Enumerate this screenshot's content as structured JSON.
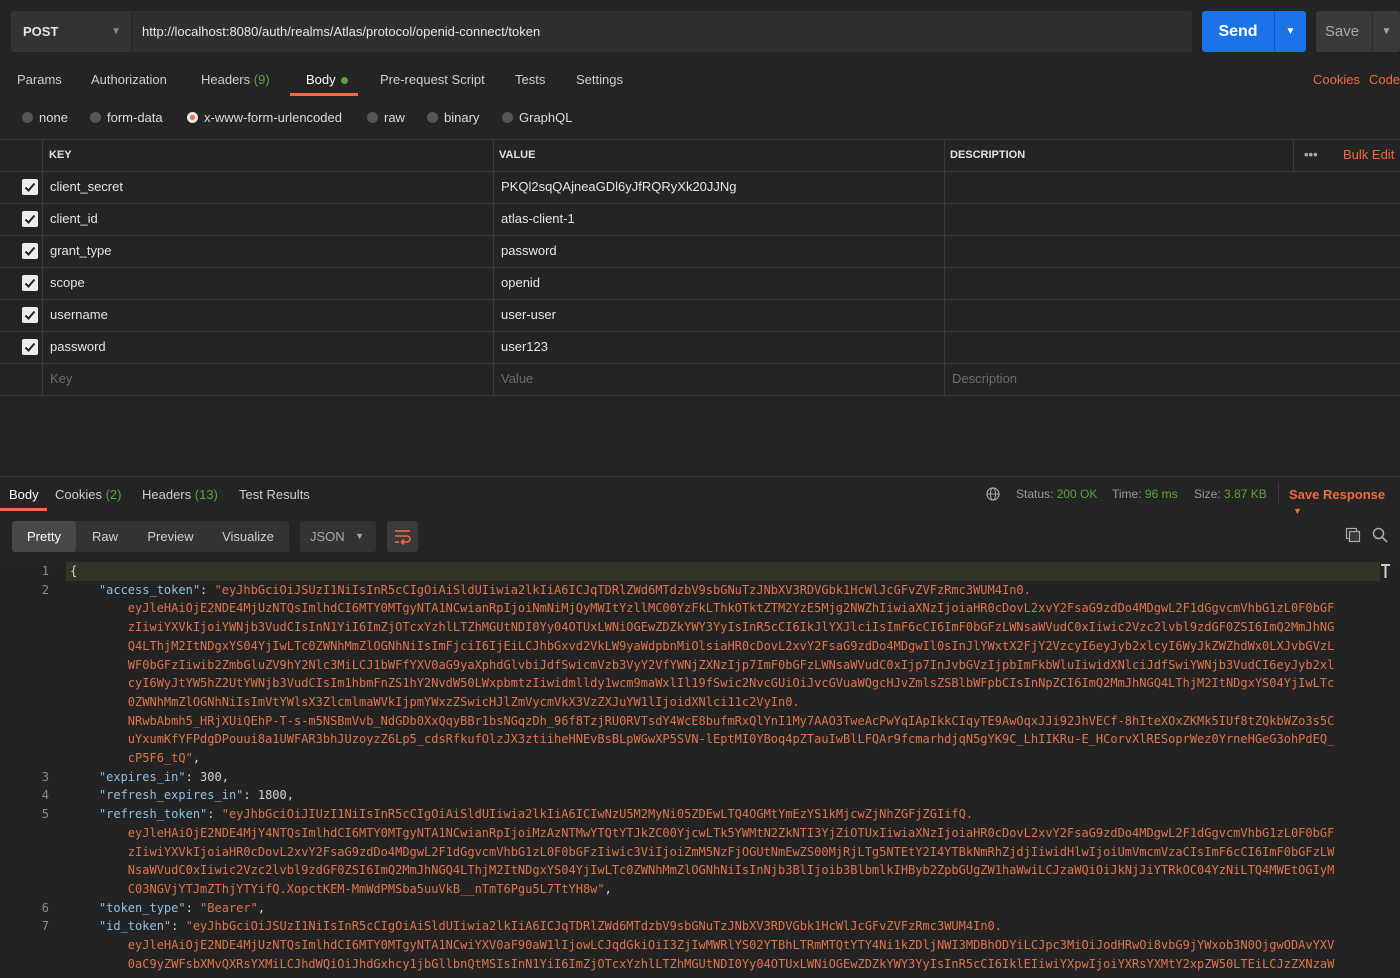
{
  "request": {
    "method": "POST",
    "url": "http://localhost:8080/auth/realms/Atlas/protocol/openid-connect/token",
    "send_label": "Send",
    "save_label": "Save"
  },
  "request_tabs": {
    "params": "Params",
    "authorization": "Authorization",
    "headers": "Headers",
    "headers_count": "(9)",
    "body": "Body",
    "pre_request": "Pre-request Script",
    "tests": "Tests",
    "settings": "Settings",
    "cookies": "Cookies",
    "code": "Code"
  },
  "body_types": {
    "none": "none",
    "form_data": "form-data",
    "urlencoded": "x-www-form-urlencoded",
    "raw": "raw",
    "binary": "binary",
    "graphql": "GraphQL",
    "selected": "x-www-form-urlencoded"
  },
  "table": {
    "headers": {
      "key": "KEY",
      "value": "VALUE",
      "description": "DESCRIPTION",
      "bulk_edit": "Bulk Edit",
      "more": "•••"
    },
    "rows": [
      {
        "key": "client_secret",
        "value": "PKQl2sqQAjneaGDl6yJfRQRyXk20JJNg",
        "checked": true
      },
      {
        "key": "client_id",
        "value": "atlas-client-1",
        "checked": true
      },
      {
        "key": "grant_type",
        "value": "password",
        "checked": true
      },
      {
        "key": "scope",
        "value": "openid",
        "checked": true
      },
      {
        "key": "username",
        "value": "user-user",
        "checked": true
      },
      {
        "key": "password",
        "value": "user123",
        "checked": true
      }
    ],
    "placeholder": {
      "key": "Key",
      "value": "Value",
      "description": "Description"
    }
  },
  "response_tabs": {
    "body": "Body",
    "cookies": "Cookies",
    "cookies_count": "(2)",
    "headers": "Headers",
    "headers_count": "(13)",
    "test_results": "Test Results"
  },
  "response_status": {
    "status_label": "Status:",
    "status_value": "200 OK",
    "time_label": "Time:",
    "time_value": "96 ms",
    "size_label": "Size:",
    "size_value": "3.87 KB",
    "save_response": "Save Response"
  },
  "view_modes": {
    "pretty": "Pretty",
    "raw": "Raw",
    "preview": "Preview",
    "visualize": "Visualize",
    "format": "JSON"
  },
  "code": {
    "lines": [
      {
        "num": "1",
        "parts": [
          [
            "p",
            "{"
          ]
        ]
      },
      {
        "num": "2",
        "parts": [
          [
            "k",
            "    \"access_token\""
          ],
          [
            "p",
            ": "
          ],
          [
            "s",
            "\"eyJhbGciOiJSUzI1NiIsInR5cCIgOiAiSldUIiwia2lkIiA6ICJqTDRlZWd6MTdzbV9sbGNuTzJNbXV3RDVGbk1HcWlJcGFvZVFzRmc3WUM4In0."
          ]
        ]
      },
      {
        "num": "",
        "parts": [
          [
            "s",
            "        eyJleHAiOjE2NDE4MjUzNTQsImlhdCI6MTY0MTgyNTA1NCwianRpIjoiNmNiMjQyMWItYzllMC00YzFkLThkOTktZTM2YzE5Mjg2NWZhIiwiaXNzIjoiaHR0cDovL2xvY2FsaG9zdDo4MDgwL2F1dGgvcmVhbG1zL0F0bGF"
          ]
        ]
      },
      {
        "num": "",
        "parts": [
          [
            "s",
            "        zIiwiYXVkIjoiYWNjb3VudCIsInN1YiI6ImZjOTcxYzhlLTZhMGUtNDI0Yy04OTUxLWNiOGEwZDZkYWY3YyIsInR5cCI6IkJlYXJlciIsImF6cCI6ImF0bGFzLWNsaWVudC0xIiwic2Vzc2lvbl9zdGF0ZSI6ImQ2MmJhNG"
          ]
        ]
      },
      {
        "num": "",
        "parts": [
          [
            "s",
            "        Q4LThjM2ItNDgxYS04YjIwLTc0ZWNhMmZlOGNhNiIsImFjciI6IjEiLCJhbGxvd2VkLW9yaWdpbnMiOlsiaHR0cDovL2xvY2FsaG9zdDo4MDgwIl0sInJlYWxtX2FjY2VzcyI6eyJyb2xlcyI6WyJkZWZhdWx0LXJvbGVzL"
          ]
        ]
      },
      {
        "num": "",
        "parts": [
          [
            "s",
            "        WF0bGFzIiwib2ZmbGluZV9hY2Nlc3MiLCJ1bWFfYXV0aG9yaXphdGlvbiJdfSwicmVzb3VyY2VfYWNjZXNzIjp7ImF0bGFzLWNsaWVudC0xIjp7InJvbGVzIjpbImFkbWluIiwidXNlciJdfSwiYWNjb3VudCI6eyJyb2xl"
          ]
        ]
      },
      {
        "num": "",
        "parts": [
          [
            "s",
            "        cyI6WyJtYW5hZ2UtYWNjb3VudCIsIm1hbmFnZS1hY2NvdW50LWxpbmtzIiwidmlldy1wcm9maWxlIl19fSwic2NvcGUiOiJvcGVuaWQgcHJvZmlsZSBlbWFpbCIsInNpZCI6ImQ2MmJhNGQ4LThjM2ItNDgxYS04YjIwLTc"
          ]
        ]
      },
      {
        "num": "",
        "parts": [
          [
            "s",
            "        0ZWNhMmZlOGNhNiIsImVtYWlsX3ZlcmlmaWVkIjpmYWxzZSwicHJlZmVycmVkX3VzZXJuYW1lIjoidXNlci11c2VyIn0."
          ]
        ]
      },
      {
        "num": "",
        "parts": [
          [
            "s",
            "        NRwbAbmh5_HRjXUiQEhP-T-s-m5NSBmVvb_NdGDb0XxQqyBBr1bsNGqzDh_96f8TzjRU0RVTsdY4WcE8bufmRxQlYnI1My7AAO3TweAcPwYqIApIkkCIqyTE9AwOqxJJi92JhVECf-8hIteXOxZKMk5IUf8tZQkbWZo3s5C"
          ]
        ]
      },
      {
        "num": "",
        "parts": [
          [
            "s",
            "        uYxumKfYFPdgDPouui8a1UWFAR3bhJUzoyzZ6Lp5_cdsRfkufOlzJX3ztiiheHNEvBsBLpWGwXP5SVN-lEptMI0YBoq4pZTauIwBlLFQAr9fcmarhdjqN5gYK9C_LhIIKRu-E_HCorvXlRESoprWez0YrneHGeG3ohPdEQ_"
          ]
        ]
      },
      {
        "num": "",
        "parts": [
          [
            "s",
            "        cP5F6_tQ\""
          ],
          [
            "p",
            ","
          ]
        ]
      },
      {
        "num": "3",
        "parts": [
          [
            "k",
            "    \"expires_in\""
          ],
          [
            "p",
            ": 300,"
          ]
        ]
      },
      {
        "num": "4",
        "parts": [
          [
            "k",
            "    \"refresh_expires_in\""
          ],
          [
            "p",
            ": 1800,"
          ]
        ]
      },
      {
        "num": "5",
        "parts": [
          [
            "k",
            "    \"refresh_token\""
          ],
          [
            "p",
            ": "
          ],
          [
            "s",
            "\"eyJhbGciOiJIUzI1NiIsInR5cCIgOiAiSldUIiwia2lkIiA6ICIwNzU5M2MyNi05ZDEwLTQ4OGMtYmEzYS1kMjcwZjNhZGFjZGIifQ."
          ]
        ]
      },
      {
        "num": "",
        "parts": [
          [
            "s",
            "        eyJleHAiOjE2NDE4MjY4NTQsImlhdCI6MTY0MTgyNTA1NCwianRpIjoiMzAzNTMwYTQtYTJkZC00YjcwLTk5YWMtN2ZkNTI3YjZiOTUxIiwiaXNzIjoiaHR0cDovL2xvY2FsaG9zdDo4MDgwL2F1dGgvcmVhbG1zL0F0bGF"
          ]
        ]
      },
      {
        "num": "",
        "parts": [
          [
            "s",
            "        zIiwiYXVkIjoiaHR0cDovL2xvY2FsaG9zdDo4MDgwL2F1dGgvcmVhbG1zL0F0bGFzIiwic3ViIjoiZmM5NzFjOGUtNmEwZS00MjRjLTg5NTEtY2I4YTBkNmRhZjdjIiwidHlwIjoiUmVmcmVzaCIsImF6cCI6ImF0bGFzLW"
          ]
        ]
      },
      {
        "num": "",
        "parts": [
          [
            "s",
            "        NsaWVudC0xIiwic2Vzc2lvbl9zdGF0ZSI6ImQ2MmJhNGQ4LThjM2ItNDgxYS04YjIwLTc0ZWNhMmZlOGNhNiIsInNjb3BlIjoib3BlbmlkIHByb2ZpbGUgZW1haWwiLCJzaWQiOiJkNjJiYTRkOC04YzNiLTQ4MWEtOGIyM"
          ]
        ]
      },
      {
        "num": "",
        "parts": [
          [
            "s",
            "        C03NGVjYTJmZThjYTYifQ.XopctKEM-MmWdPMSba5uuVkB__nTmT6Pgu5L7TtYH8w\""
          ],
          [
            "p",
            ","
          ]
        ]
      },
      {
        "num": "6",
        "parts": [
          [
            "k",
            "    \"token_type\""
          ],
          [
            "p",
            ": "
          ],
          [
            "s",
            "\"Bearer\""
          ],
          [
            "p",
            ","
          ]
        ]
      },
      {
        "num": "7",
        "parts": [
          [
            "k",
            "    \"id_token\""
          ],
          [
            "p",
            ": "
          ],
          [
            "s",
            "\"eyJhbGciOiJSUzI1NiIsInR5cCIgOiAiSldUIiwia2lkIiA6ICJqTDRlZWd6MTdzbV9sbGNuTzJNbXV3RDVGbk1HcWlJcGFvZVFzRmc3WUM4In0."
          ]
        ]
      },
      {
        "num": "",
        "parts": [
          [
            "s",
            "        eyJleHAiOjE2NDE4MjUzNTQsImlhdCI6MTY0MTgyNTA1NCwiYXV0aF90aW1lIjowLCJqdGkiOiI3ZjIwMWRlYS02YTBhLTRmMTQtYTY4Ni1kZDljNWI3MDBhODYiLCJpc3MiOiJodHRwOi8vbG9jYWxob3N0OjgwODAvYXV"
          ]
        ]
      },
      {
        "num": "",
        "parts": [
          [
            "s",
            "        0aC9yZWFsbXMvQXRsYXMiLCJhdWQiOiJhdGxhcy1jbGllbnQtMSIsInN1YiI6ImZjOTcxYzhlLTZhMGUtNDI0Yy04OTUxLWNiOGEwZDZkYWY3YyIsInR5cCI6IklEIiwiYXpwIjoiYXRsYXMtY2xpZW50LTEiLCJzZXNzaW"
          ]
        ]
      }
    ]
  }
}
